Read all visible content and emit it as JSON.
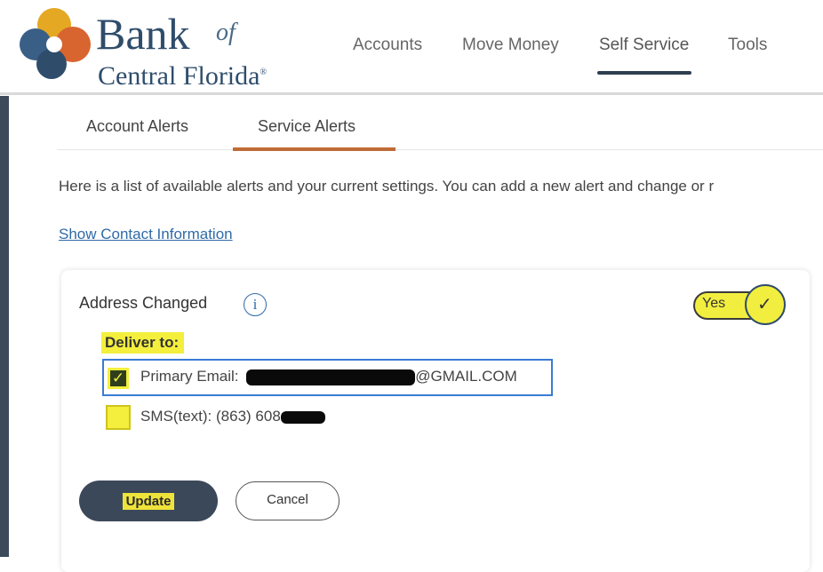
{
  "brand": {
    "name_bank": "Bank",
    "name_of": "of",
    "name_region": "Central Florida",
    "registered": "®",
    "logo_colors": [
      "#e5a823",
      "#d8642f",
      "#3a5f86",
      "#2f4d6b"
    ]
  },
  "nav": {
    "items": [
      {
        "label": "Accounts"
      },
      {
        "label": "Move Money"
      },
      {
        "label": "Self Service",
        "active": true
      },
      {
        "label": "Tools"
      }
    ]
  },
  "tabs": [
    {
      "label": "Account Alerts"
    },
    {
      "label": "Service Alerts",
      "active": true
    }
  ],
  "intro_text": "Here is a list of available alerts and your current settings. You can add a new alert and change or r",
  "contact_link": "Show Contact Information",
  "alert": {
    "name": "Address Changed",
    "info_icon": "i",
    "toggle_label": "Yes",
    "toggle_on": true,
    "deliver_to_label": "Deliver to:",
    "options": [
      {
        "label": "Primary Email:",
        "value_suffix": "@GMAIL.COM",
        "checked": true,
        "value_redacted": true
      },
      {
        "label": "SMS(text): (863) 608",
        "checked": false,
        "value_redacted": true
      }
    ]
  },
  "buttons": {
    "update": "Update",
    "cancel": "Cancel"
  },
  "colors": {
    "accent_orange": "#c06a35",
    "navy": "#2d3e50",
    "link_blue": "#2f6aa8",
    "highlight_yellow": "#f4ef3c"
  }
}
